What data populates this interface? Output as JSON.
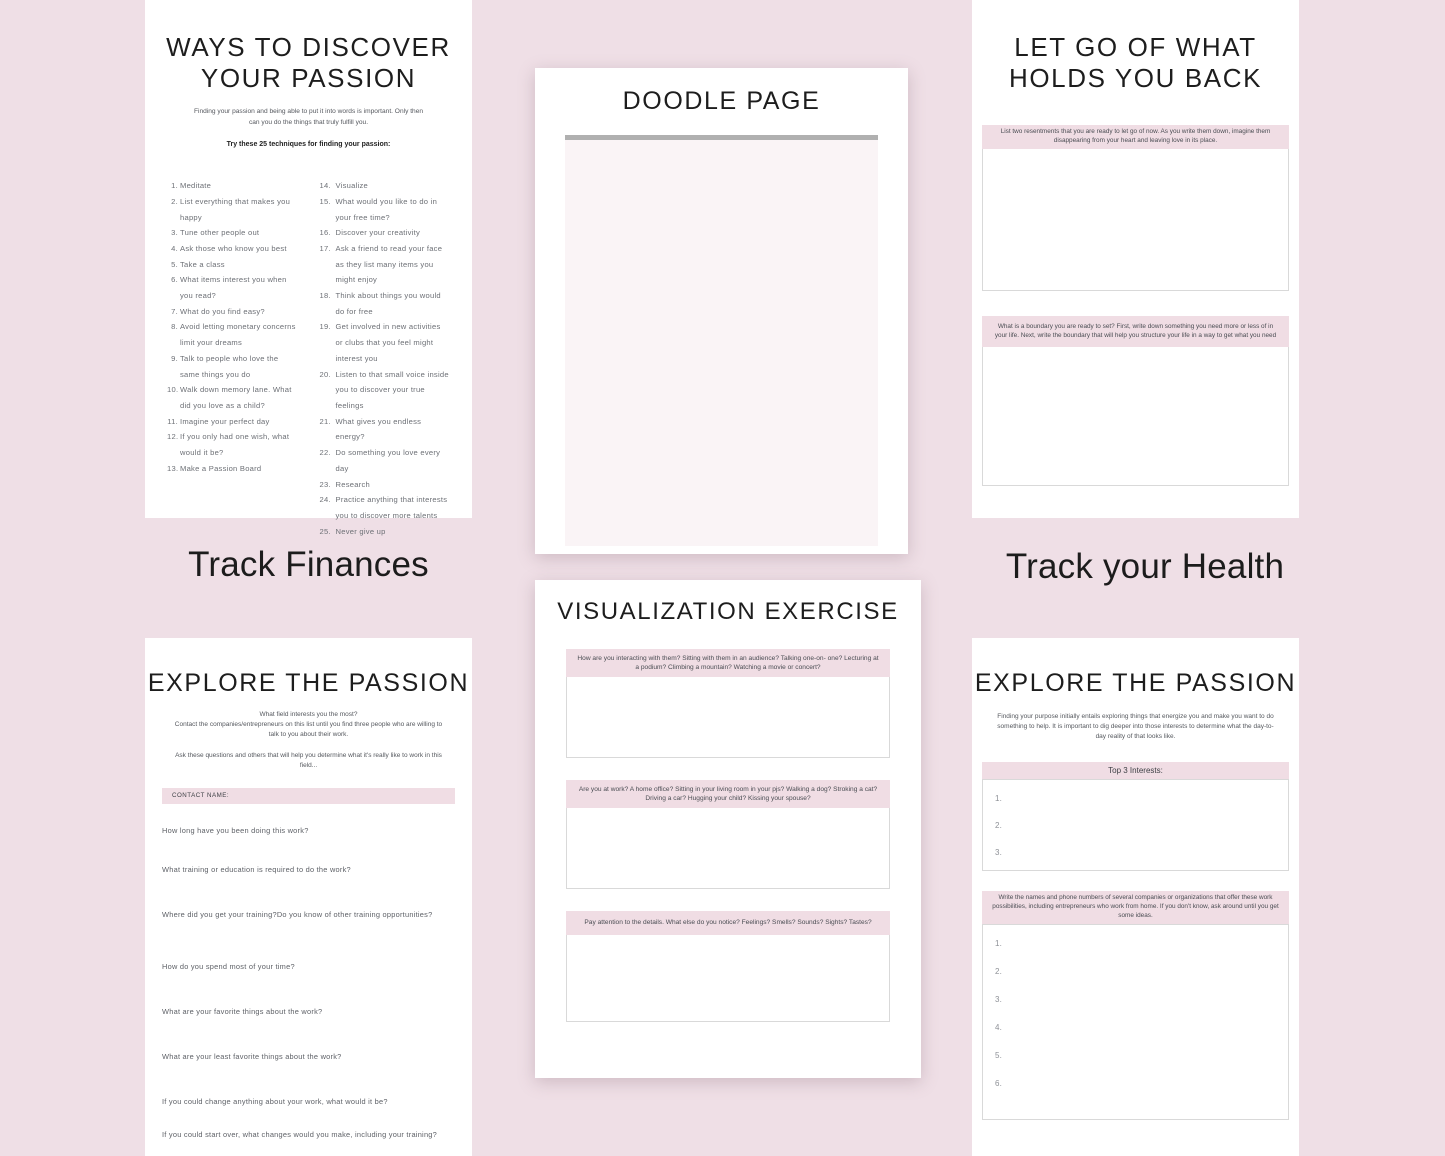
{
  "theme": {
    "background": "#efdfe6",
    "card_background": "#ffffff",
    "prompt_header_pink": "#f0dde4",
    "doodle_fill": "#faf4f6",
    "doodle_bar": "#b0b0b0",
    "text_dark": "#1d1d1d",
    "text_body": "#5e6167"
  },
  "bg_headings": {
    "track_finances": "Track Finances",
    "track_health": "Track your Health"
  },
  "card_passion": {
    "title_line1": "WAYS TO DISCOVER",
    "title_line2": "YOUR PASSION",
    "intro": "Finding your passion and being able to put it into words is important. Only then can you do the things that truly fulfill you.",
    "subhead": "Try these 25 techniques for finding your passion:",
    "left_items": [
      {
        "n": "1.",
        "t": "Meditate"
      },
      {
        "n": "2.",
        "t": "List everything that makes you happy"
      },
      {
        "n": "3.",
        "t": "Tune other people out"
      },
      {
        "n": "4.",
        "t": "Ask those who know you best"
      },
      {
        "n": "5.",
        "t": "Take a class"
      },
      {
        "n": "6.",
        "t": "What items interest you when you read?"
      },
      {
        "n": "7.",
        "t": "What do you find easy?"
      },
      {
        "n": "8.",
        "t": "Avoid letting monetary concerns limit your dreams"
      },
      {
        "n": "9.",
        "t": "Talk to people who love the same things you do"
      },
      {
        "n": "10.",
        "t": "Walk down memory lane. What did you love as a child?"
      },
      {
        "n": "11.",
        "t": "Imagine your perfect day"
      },
      {
        "n": "12.",
        "t": "If you only had one wish, what would it be?"
      },
      {
        "n": "13.",
        "t": "Make a Passion Board"
      }
    ],
    "right_items": [
      {
        "n": "14.",
        "t": "Visualize"
      },
      {
        "n": "15.",
        "t": "What would you like to do in your free time?"
      },
      {
        "n": "16.",
        "t": "Discover your creativity"
      },
      {
        "n": "17.",
        "t": "Ask a friend to read your face as they list many items you might enjoy"
      },
      {
        "n": "18.",
        "t": "Think about things you would do for free"
      },
      {
        "n": "19.",
        "t": "Get involved in new activities or clubs that you feel might interest you"
      },
      {
        "n": "20.",
        "t": "Listen to that small voice inside you to discover your true feelings"
      },
      {
        "n": "21.",
        "t": "What gives you endless energy?"
      },
      {
        "n": "22.",
        "t": "Do something you love every day"
      },
      {
        "n": "23.",
        "t": "Research"
      },
      {
        "n": "24.",
        "t": "Practice anything that interests you to discover more talents"
      },
      {
        "n": "25.",
        "t": "Never give up"
      }
    ]
  },
  "card_doodle": {
    "title": "DOODLE PAGE"
  },
  "card_letgo": {
    "title_line1": "LET GO OF WHAT",
    "title_line2": "HOLDS YOU BACK",
    "prompts": [
      "List two resentments that you are ready to let go of now. As you write them down, imagine them disappearing from your heart and leaving love in its place.",
      "What is a boundary you are ready to set? First, write down something you need more or less of in your life. Next, write the boundary that will help you structure your life in a way to get what you need"
    ]
  },
  "card_explore_contacts": {
    "title": "EXPLORE THE PASSION",
    "intro_line1": "What field interests you the most?",
    "intro_line2": "Contact the companies/entrepreneurs on this list until you find three people who are willing to talk to you about their work.",
    "intro_line3": "Ask these questions and others that will help you determine what it's really like to work in this field...",
    "contact_label": "CONTACT NAME:",
    "questions": [
      "How long have you been doing this work?",
      "What training or education is required to do the work?",
      "Where did you get your training?Do you know of other training opportunities?",
      "How do you spend most of your time?",
      "What are your favorite things about the work?",
      "What are your least favorite things about the work?",
      "If you could change anything about your work, what would it be?",
      "If you could start over, what changes would you make, including your training?"
    ]
  },
  "card_visualization": {
    "title": "VISUALIZATION EXERCISE",
    "prompts": [
      "How are you interacting with them? Sitting with them in an audience? Talking one-on- one? Lecturing at a podium? Climbing a mountain? Watching a movie or concert?",
      "Are you at work? A home office? Sitting in your living room in your pjs? Walking a dog? Stroking a cat? Driving a car? Hugging your child? Kissing your spouse?",
      "Pay attention to the details. What else do you notice? Feelings? Smells? Sounds? Sights? Tastes?"
    ]
  },
  "card_explore_interests": {
    "title": "EXPLORE THE PASSION",
    "intro": "Finding your purpose initially entails exploring things that energize you and make you want to do something to help. It is important to dig deeper into those interests to determine what the day-to-day reality of that looks like.",
    "top3_label": "Top 3 Interests:",
    "top3_numbers": [
      "1.",
      "2.",
      "3."
    ],
    "companies_prompt": "Write the names and phone numbers of several companies or organizations that offer these work possibilities, including entrepreneurs who work from home. If you don't know, ask around until you get some ideas.",
    "companies_numbers": [
      "1.",
      "2.",
      "3.",
      "4.",
      "5.",
      "6."
    ]
  }
}
